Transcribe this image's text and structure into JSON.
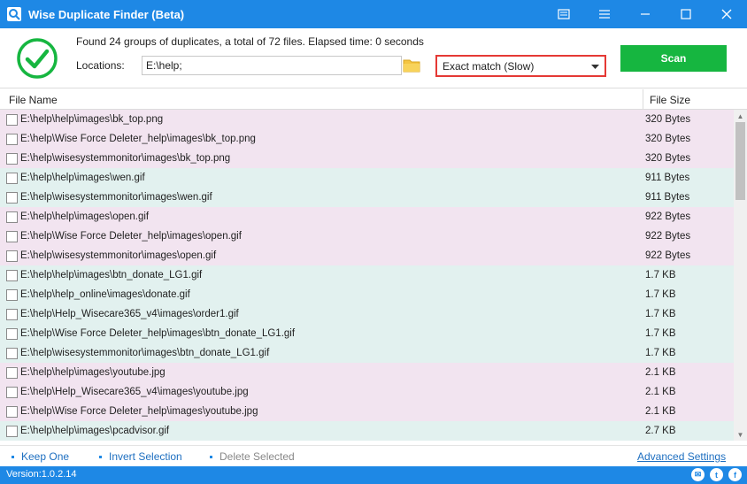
{
  "window": {
    "title": "Wise Duplicate Finder (Beta)"
  },
  "toolbar": {
    "status": "Found 24 groups of duplicates, a total of 72 files. Elapsed time: 0 seconds",
    "locations_label": "Locations:",
    "locations_value": "E:\\help;",
    "match_mode": "Exact match (Slow)",
    "scan_label": "Scan"
  },
  "columns": {
    "name": "File Name",
    "size": "File Size"
  },
  "rows": [
    {
      "name": "E:\\help\\help\\images\\bk_top.png",
      "size": "320 Bytes",
      "color": "#f2e4f0"
    },
    {
      "name": "E:\\help\\Wise Force Deleter_help\\images\\bk_top.png",
      "size": "320 Bytes",
      "color": "#f2e4f0"
    },
    {
      "name": "E:\\help\\wisesystemmonitor\\images\\bk_top.png",
      "size": "320 Bytes",
      "color": "#f2e4f0"
    },
    {
      "name": "E:\\help\\help\\images\\wen.gif",
      "size": "911 Bytes",
      "color": "#e2f1ef"
    },
    {
      "name": "E:\\help\\wisesystemmonitor\\images\\wen.gif",
      "size": "911 Bytes",
      "color": "#e2f1ef"
    },
    {
      "name": "E:\\help\\help\\images\\open.gif",
      "size": "922 Bytes",
      "color": "#f2e4f0"
    },
    {
      "name": "E:\\help\\Wise Force Deleter_help\\images\\open.gif",
      "size": "922 Bytes",
      "color": "#f2e4f0"
    },
    {
      "name": "E:\\help\\wisesystemmonitor\\images\\open.gif",
      "size": "922 Bytes",
      "color": "#f2e4f0"
    },
    {
      "name": "E:\\help\\help\\images\\btn_donate_LG1.gif",
      "size": "1.7 KB",
      "color": "#e2f1ef"
    },
    {
      "name": "E:\\help\\help_online\\images\\donate.gif",
      "size": "1.7 KB",
      "color": "#e2f1ef"
    },
    {
      "name": "E:\\help\\Help_Wisecare365_v4\\images\\order1.gif",
      "size": "1.7 KB",
      "color": "#e2f1ef"
    },
    {
      "name": "E:\\help\\Wise Force Deleter_help\\images\\btn_donate_LG1.gif",
      "size": "1.7 KB",
      "color": "#e2f1ef"
    },
    {
      "name": "E:\\help\\wisesystemmonitor\\images\\btn_donate_LG1.gif",
      "size": "1.7 KB",
      "color": "#e2f1ef"
    },
    {
      "name": "E:\\help\\help\\images\\youtube.jpg",
      "size": "2.1 KB",
      "color": "#f2e4f0"
    },
    {
      "name": "E:\\help\\Help_Wisecare365_v4\\images\\youtube.jpg",
      "size": "2.1 KB",
      "color": "#f2e4f0"
    },
    {
      "name": "E:\\help\\Wise Force Deleter_help\\images\\youtube.jpg",
      "size": "2.1 KB",
      "color": "#f2e4f0"
    },
    {
      "name": "E:\\help\\help\\images\\pcadvisor.gif",
      "size": "2.7 KB",
      "color": "#e2f1ef"
    }
  ],
  "footer": {
    "keep_one": "Keep One",
    "invert_selection": "Invert Selection",
    "delete_selected": "Delete Selected",
    "advanced_settings": "Advanced Settings"
  },
  "statusbar": {
    "version": "Version:1.0.2.14"
  },
  "icons": {
    "app": "app-logo-icon",
    "check": "success-check-icon",
    "folder": "folder-icon",
    "dropdown": "chevron-down-icon",
    "email": "email-icon",
    "twitter": "twitter-icon",
    "facebook": "facebook-icon"
  },
  "colors": {
    "accent": "#1e88e5",
    "scan": "#16b640",
    "highlight": "#e53935",
    "group_a": "#f2e4f0",
    "group_b": "#e2f1ef"
  }
}
